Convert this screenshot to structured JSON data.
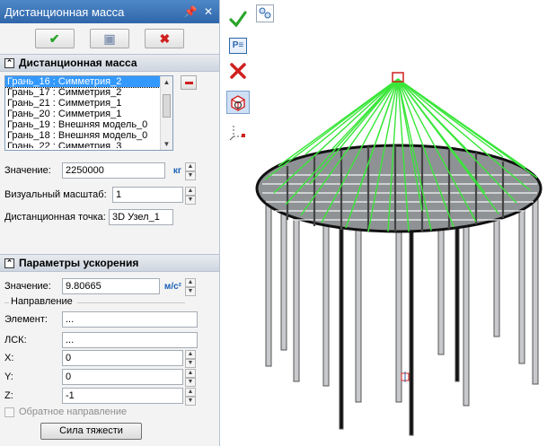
{
  "window": {
    "title": "Дистанционная масса",
    "pin_icon": "pin-icon",
    "close_icon": "close-icon"
  },
  "top_buttons": {
    "ok_icon": "check-icon",
    "preview_icon": "preview-icon",
    "cancel_icon": "x-icon"
  },
  "section1": {
    "title": "Дистанционная масса",
    "list_items": [
      "Грань_16 : Симметрия_2",
      "Грань_17 : Симметрия_2",
      "Грань_21 : Симметрия_1",
      "Грань_20 : Симметрия_1",
      "Грань_19 : Внешняя модель_0",
      "Грань_18 : Внешняя модель_0",
      "Грань_22 : Симметрия_3"
    ],
    "value_label": "Значение:",
    "value": "2250000",
    "value_unit": "кг",
    "scale_label": "Визуальный масштаб:",
    "scale_value": "1",
    "point_label": "Дистанционная точка:",
    "point_value": "3D Узел_1"
  },
  "section2": {
    "title": "Параметры ускорения",
    "value_label": "Значение:",
    "value": "9.80665",
    "value_unit": "м/с²",
    "direction_label": "Направление",
    "element_label": "Элемент:",
    "element_value": "...",
    "lsk_label": "ЛСК:",
    "lsk_value": "...",
    "x_label": "X:",
    "x_value": "0",
    "y_label": "Y:",
    "y_value": "0",
    "z_label": "Z:",
    "z_value": "-1",
    "reverse_label": "Обратное направление",
    "gravity_button": "Сила тяжести"
  },
  "toolbar": {
    "items": [
      "check-icon",
      "report-icon",
      "x-icon",
      "cube-icon",
      "axes-icon"
    ],
    "report_text": "P≡"
  },
  "colors": {
    "accent": "#2f66aa",
    "wire": "#39e639",
    "ok": "#2aa52a",
    "cancel": "#d02020"
  }
}
